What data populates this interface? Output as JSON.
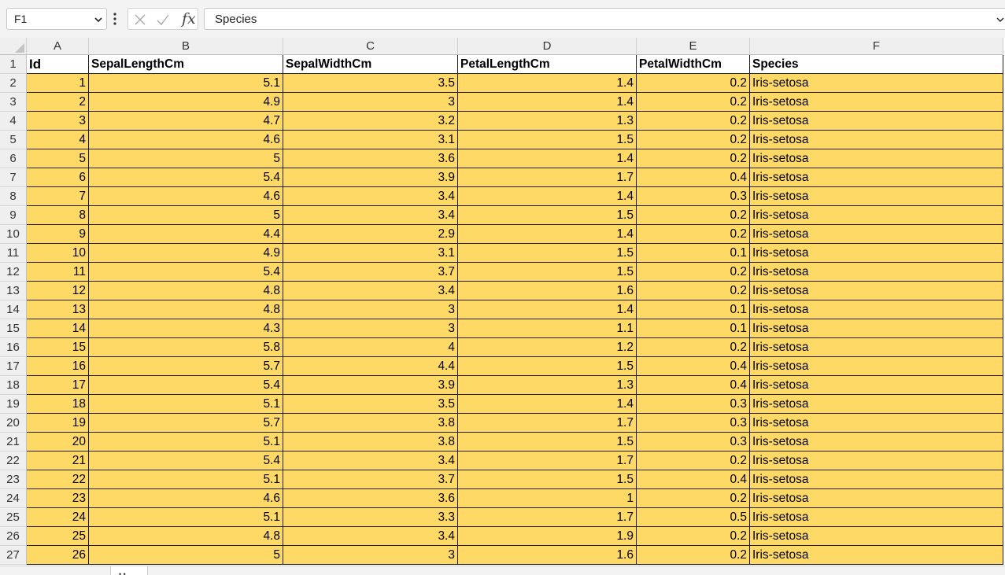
{
  "formula_bar": {
    "name_box": "F1",
    "fx_label": "fx",
    "formula_value": "Species"
  },
  "columns": [
    "A",
    "B",
    "C",
    "D",
    "E",
    "F"
  ],
  "headers": [
    "Id",
    "SepalLengthCm",
    "SepalWidthCm",
    "PetalLengthCm",
    "PetalWidthCm",
    "Species"
  ],
  "rows": [
    [
      "1",
      "5.1",
      "3.5",
      "1.4",
      "0.2",
      "Iris-setosa"
    ],
    [
      "2",
      "4.9",
      "3",
      "1.4",
      "0.2",
      "Iris-setosa"
    ],
    [
      "3",
      "4.7",
      "3.2",
      "1.3",
      "0.2",
      "Iris-setosa"
    ],
    [
      "4",
      "4.6",
      "3.1",
      "1.5",
      "0.2",
      "Iris-setosa"
    ],
    [
      "5",
      "5",
      "3.6",
      "1.4",
      "0.2",
      "Iris-setosa"
    ],
    [
      "6",
      "5.4",
      "3.9",
      "1.7",
      "0.4",
      "Iris-setosa"
    ],
    [
      "7",
      "4.6",
      "3.4",
      "1.4",
      "0.3",
      "Iris-setosa"
    ],
    [
      "8",
      "5",
      "3.4",
      "1.5",
      "0.2",
      "Iris-setosa"
    ],
    [
      "9",
      "4.4",
      "2.9",
      "1.4",
      "0.2",
      "Iris-setosa"
    ],
    [
      "10",
      "4.9",
      "3.1",
      "1.5",
      "0.1",
      "Iris-setosa"
    ],
    [
      "11",
      "5.4",
      "3.7",
      "1.5",
      "0.2",
      "Iris-setosa"
    ],
    [
      "12",
      "4.8",
      "3.4",
      "1.6",
      "0.2",
      "Iris-setosa"
    ],
    [
      "13",
      "4.8",
      "3",
      "1.4",
      "0.1",
      "Iris-setosa"
    ],
    [
      "14",
      "4.3",
      "3",
      "1.1",
      "0.1",
      "Iris-setosa"
    ],
    [
      "15",
      "5.8",
      "4",
      "1.2",
      "0.2",
      "Iris-setosa"
    ],
    [
      "16",
      "5.7",
      "4.4",
      "1.5",
      "0.4",
      "Iris-setosa"
    ],
    [
      "17",
      "5.4",
      "3.9",
      "1.3",
      "0.4",
      "Iris-setosa"
    ],
    [
      "18",
      "5.1",
      "3.5",
      "1.4",
      "0.3",
      "Iris-setosa"
    ],
    [
      "19",
      "5.7",
      "3.8",
      "1.7",
      "0.3",
      "Iris-setosa"
    ],
    [
      "20",
      "5.1",
      "3.8",
      "1.5",
      "0.3",
      "Iris-setosa"
    ],
    [
      "21",
      "5.4",
      "3.4",
      "1.7",
      "0.2",
      "Iris-setosa"
    ],
    [
      "22",
      "5.1",
      "3.7",
      "1.5",
      "0.4",
      "Iris-setosa"
    ],
    [
      "23",
      "4.6",
      "3.6",
      "1",
      "0.2",
      "Iris-setosa"
    ],
    [
      "24",
      "5.1",
      "3.3",
      "1.7",
      "0.5",
      "Iris-setosa"
    ],
    [
      "25",
      "4.8",
      "3.4",
      "1.9",
      "0.2",
      "Iris-setosa"
    ],
    [
      "26",
      "5",
      "3",
      "1.6",
      "0.2",
      "Iris-setosa"
    ]
  ],
  "colors": {
    "data_fill": "#ffd966",
    "header_fill": "#efefef"
  }
}
